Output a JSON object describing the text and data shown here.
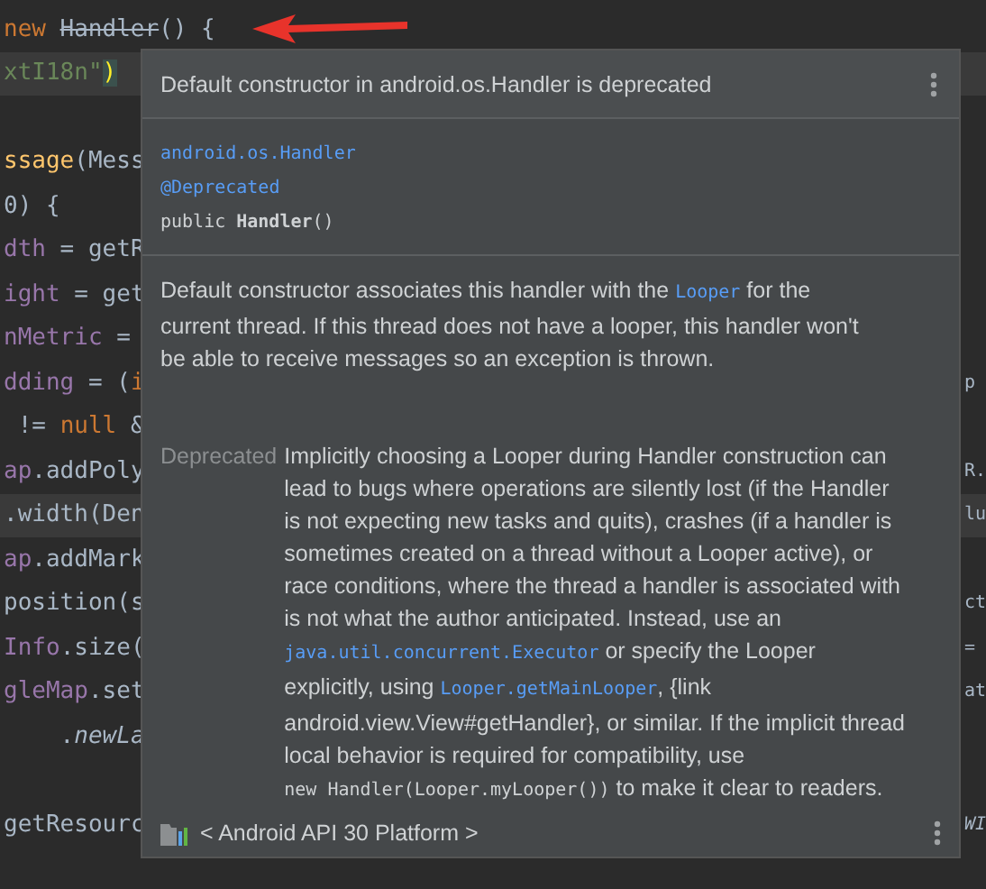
{
  "editor": {
    "lines": [
      {
        "highlight": false,
        "left": [
          {
            "kind": "keyword",
            "text": "new"
          },
          {
            "kind": "deprecated",
            "text": "Handler"
          },
          {
            "kind": "plain",
            "text": "() {"
          }
        ]
      },
      {
        "highlight": true,
        "left": [
          {
            "kind": "string",
            "text": "xtI18n\""
          },
          {
            "kind": "matched",
            "text": ")"
          }
        ]
      },
      {
        "highlight": false
      },
      {
        "highlight": false,
        "left": [
          {
            "kind": "method",
            "text": "ssage"
          },
          {
            "kind": "plain",
            "text": "(Mess"
          }
        ]
      },
      {
        "highlight": false,
        "left": [
          {
            "kind": "plain",
            "text": "0) {"
          }
        ]
      },
      {
        "highlight": false,
        "left": [
          {
            "kind": "field",
            "text": "dth"
          },
          {
            "kind": "plain",
            "text": " = getR"
          }
        ]
      },
      {
        "highlight": false,
        "left": [
          {
            "kind": "field",
            "text": "ight"
          },
          {
            "kind": "plain",
            "text": " = get"
          }
        ]
      },
      {
        "highlight": false,
        "left": [
          {
            "kind": "field",
            "text": "nMetric"
          },
          {
            "kind": "plain",
            "text": " ="
          }
        ]
      },
      {
        "highlight": false,
        "left": [
          {
            "kind": "field",
            "text": "dding"
          },
          {
            "kind": "plain",
            "text": " = ("
          },
          {
            "kind": "keyword",
            "text": "i"
          }
        ],
        "right": [
          {
            "kind": "plain",
            "text": "p"
          }
        ]
      },
      {
        "highlight": false,
        "left": [
          {
            "kind": "plain",
            "text": " != "
          },
          {
            "kind": "keyword",
            "text": "null"
          },
          {
            "kind": "plain",
            "text": " &"
          }
        ]
      },
      {
        "highlight": false,
        "left": [
          {
            "kind": "field",
            "text": "ap"
          },
          {
            "kind": "plain",
            "text": ".addPoly"
          }
        ],
        "right": [
          {
            "kind": "plain",
            "text": "R."
          }
        ]
      },
      {
        "highlight": true,
        "left": [
          {
            "kind": "plain",
            "text": ".width(Den"
          }
        ],
        "right": [
          {
            "kind": "plain",
            "text": "lu"
          }
        ]
      },
      {
        "highlight": false,
        "left": [
          {
            "kind": "field",
            "text": "ap"
          },
          {
            "kind": "plain",
            "text": ".addMark"
          }
        ]
      },
      {
        "highlight": false,
        "left": [
          {
            "kind": "plain",
            "text": "position(s"
          }
        ],
        "right": [
          {
            "kind": "plain",
            "text": "ct"
          }
        ]
      },
      {
        "highlight": false,
        "left": [
          {
            "kind": "field",
            "text": "Info"
          },
          {
            "kind": "plain",
            "text": ".size("
          }
        ],
        "right": [
          {
            "kind": "plain",
            "text": "="
          }
        ]
      },
      {
        "highlight": false,
        "left": [
          {
            "kind": "field",
            "text": "gleMap"
          },
          {
            "kind": "plain",
            "text": ".set"
          }
        ],
        "right": [
          {
            "kind": "plain",
            "text": "at"
          }
        ]
      },
      {
        "highlight": false,
        "left": [
          {
            "kind": "plain",
            "text": "    ."
          },
          {
            "kind": "italic",
            "text": "newLa"
          }
        ]
      },
      {
        "highlight": false
      },
      {
        "highlight": false,
        "left": [
          {
            "kind": "plain",
            "text": "getResourc"
          }
        ],
        "right": [
          {
            "kind": "italic",
            "text": "WI"
          }
        ]
      }
    ]
  },
  "popup": {
    "title": "Default constructor in android.os.Handler is deprecated",
    "signature": {
      "package": "android.os.Handler",
      "annotation": "@Deprecated",
      "modifier": "public",
      "name": "Handler",
      "params": "()"
    },
    "description": [
      {
        "kind": "text",
        "text": "Default constructor associates this handler with the "
      },
      {
        "kind": "code",
        "text": "Looper"
      },
      {
        "kind": "text",
        "text": " for the current thread. If this thread does not have a looper, this handler won't be able to receive messages so an exception is thrown."
      }
    ],
    "deprecated": {
      "label": "Deprecated",
      "text": [
        {
          "kind": "text",
          "text": "Implicitly choosing a Looper during Handler construction can lead to bugs where operations are silently lost (if the Handler is not expecting new tasks and quits), crashes (if a handler is sometimes created on a thread without a Looper active), or race conditions, where the thread a handler is associated with is not what the author anticipated. Instead, use an "
        },
        {
          "kind": "code",
          "text": "java.util.concurrent.Executor"
        },
        {
          "kind": "text",
          "text": " or specify the Looper explicitly, using "
        },
        {
          "kind": "code",
          "text": "Looper.getMainLooper"
        },
        {
          "kind": "text",
          "text": ", {link android.view.View#getHandler}, or similar. If the implicit thread local behavior is required for compatibility, use "
        },
        {
          "kind": "plaincode",
          "text": "new Handler(Looper.myLooper())"
        },
        {
          "kind": "text",
          "text": " to make it clear to readers."
        }
      ]
    },
    "footer": "< Android API 30 Platform >"
  }
}
